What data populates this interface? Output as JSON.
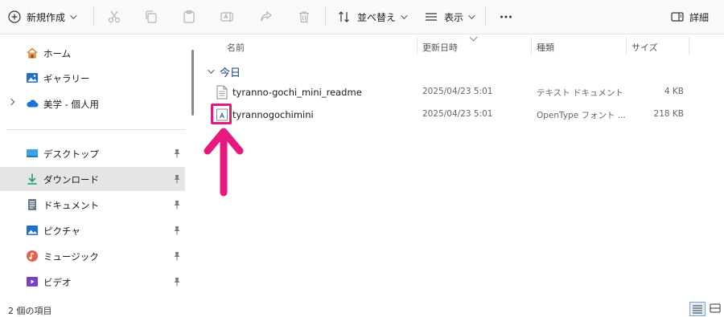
{
  "toolbar": {
    "new_label": "新規作成",
    "sort_label": "並べ替え",
    "view_label": "表示",
    "detail_label": "詳細"
  },
  "sidebar": {
    "items": [
      {
        "label": "ホーム",
        "icon": "home-icon"
      },
      {
        "label": "ギャラリー",
        "icon": "gallery-icon"
      },
      {
        "label": "美学 - 個人用",
        "icon": "onedrive-cloud-icon"
      },
      {
        "label": "デスクトップ",
        "icon": "desktop-folder-icon",
        "pinned": true
      },
      {
        "label": "ダウンロード",
        "icon": "download-folder-icon",
        "pinned": true,
        "selected": true
      },
      {
        "label": "ドキュメント",
        "icon": "documents-folder-icon",
        "pinned": true
      },
      {
        "label": "ピクチャ",
        "icon": "pictures-folder-icon",
        "pinned": true
      },
      {
        "label": "ミュージック",
        "icon": "music-folder-icon",
        "pinned": true
      },
      {
        "label": "ビデオ",
        "icon": "videos-folder-icon",
        "pinned": true
      }
    ]
  },
  "columns": {
    "name": "名前",
    "date": "更新日時",
    "type": "種類",
    "size": "サイズ"
  },
  "group": {
    "label": "今日"
  },
  "files": [
    {
      "name": "tyranno-gochi_mini_readme",
      "date": "2025/04/23 5:01",
      "type": "テキスト ドキュメント",
      "size": "4 KB",
      "icon": "text-document-icon"
    },
    {
      "name": "tyrannogochimini",
      "date": "2025/04/23 5:01",
      "type": "OpenType フォント ...",
      "size": "218 KB",
      "icon": "font-file-icon"
    }
  ],
  "status": {
    "count": "2 個の項目"
  },
  "colors": {
    "highlight": "#e8197e",
    "accent": "#0067c0"
  }
}
